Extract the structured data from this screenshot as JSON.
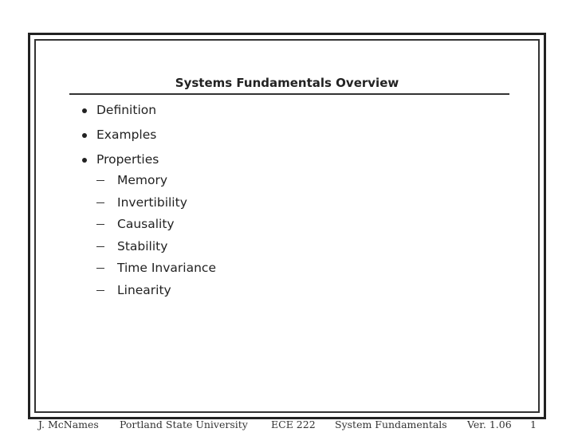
{
  "slide": {
    "title": "Systems Fundamentals Overview",
    "items": [
      {
        "label": "Definition"
      },
      {
        "label": "Examples"
      },
      {
        "label": "Properties",
        "subitems": [
          "Memory",
          "Invertibility",
          "Causality",
          "Stability",
          "Time Invariance",
          "Linearity"
        ]
      }
    ]
  },
  "footer": {
    "author": "J. McNames",
    "institution": "Portland State University",
    "course": "ECE 222",
    "topic": "System Fundamentals",
    "version": "Ver. 1.06",
    "page": "1"
  }
}
